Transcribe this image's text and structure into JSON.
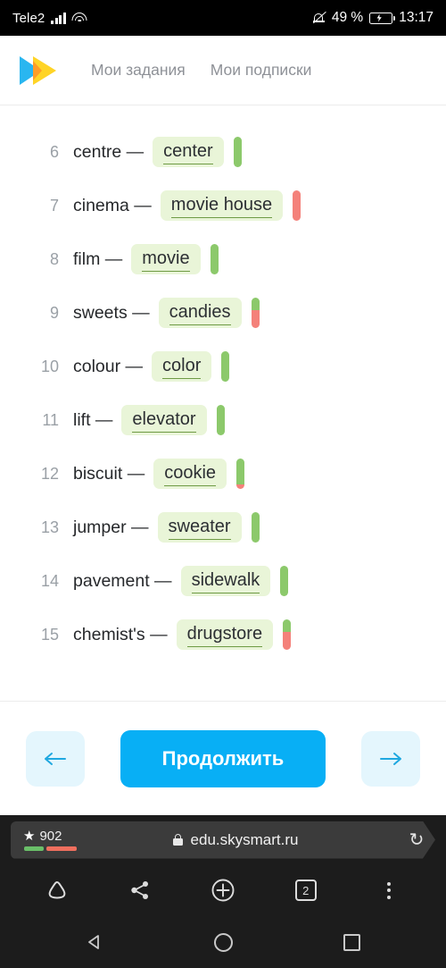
{
  "statusbar": {
    "carrier": "Tele2",
    "battery_percent": "49 %",
    "time": "13:17",
    "icons": [
      "signal-icon",
      "wifi-icon",
      "mute-icon",
      "battery-icon"
    ]
  },
  "app": {
    "logo": "skysmart-logo",
    "nav": [
      {
        "label": "Мои задания"
      },
      {
        "label": "Мои подписки"
      }
    ]
  },
  "exercise": {
    "rows": [
      {
        "num": "6",
        "prompt": "centre —",
        "answer": "center",
        "green_pct": 100,
        "red_pct": 0
      },
      {
        "num": "7",
        "prompt": "cinema —",
        "answer": "movie house",
        "green_pct": 0,
        "red_pct": 100
      },
      {
        "num": "8",
        "prompt": "film —",
        "answer": "movie",
        "green_pct": 100,
        "red_pct": 0
      },
      {
        "num": "9",
        "prompt": "sweets —",
        "answer": "candies",
        "green_pct": 40,
        "red_pct": 60
      },
      {
        "num": "10",
        "prompt": "colour —",
        "answer": "color",
        "green_pct": 100,
        "red_pct": 0
      },
      {
        "num": "11",
        "prompt": "lift —",
        "answer": "elevator",
        "green_pct": 100,
        "red_pct": 0
      },
      {
        "num": "12",
        "prompt": "biscuit —",
        "answer": "cookie",
        "green_pct": 85,
        "red_pct": 15
      },
      {
        "num": "13",
        "prompt": "jumper —",
        "answer": "sweater",
        "green_pct": 100,
        "red_pct": 0
      },
      {
        "num": "14",
        "prompt": "pavement —",
        "answer": "sidewalk",
        "green_pct": 100,
        "red_pct": 0
      },
      {
        "num": "15",
        "prompt": "chemist's —",
        "answer": "drugstore",
        "green_pct": 40,
        "red_pct": 60
      }
    ]
  },
  "footer": {
    "prev_icon": "arrow-left-icon",
    "continue_label": "Продолжить",
    "next_icon": "arrow-right-icon"
  },
  "browser": {
    "star_count": "902",
    "url": "edu.skysmart.ru",
    "lock_icon": "lock-icon",
    "reload_icon": "reload-icon",
    "tab_count": "2",
    "toolbar_icons": [
      "home-icon",
      "share-icon",
      "new-tab-icon",
      "tab-switcher-icon",
      "overflow-menu-icon"
    ]
  },
  "system_nav": {
    "back_icon": "back-triangle-icon",
    "home_icon": "home-circle-icon",
    "recents_icon": "recents-square-icon"
  },
  "colors": {
    "accent_blue": "#08aff5",
    "answer_bg": "#e9f5d8",
    "score_green": "#8cc96b",
    "score_red": "#f4817a"
  }
}
